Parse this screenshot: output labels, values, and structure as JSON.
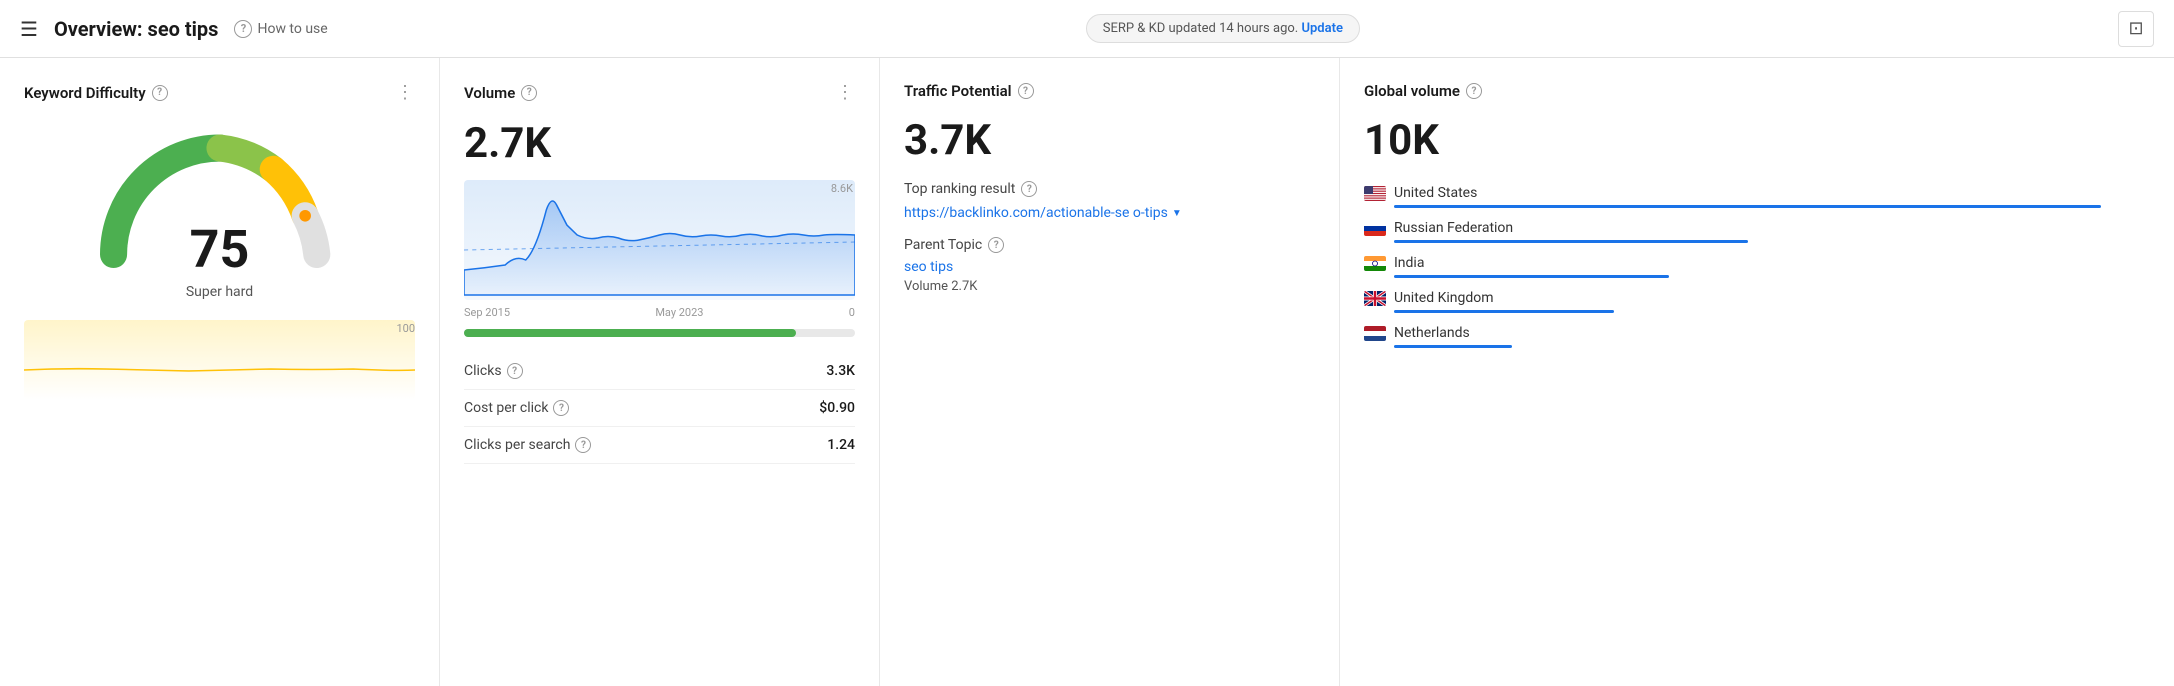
{
  "header": {
    "menu_icon": "☰",
    "title": "Overview: seo tips",
    "help_label": "How to use",
    "serp_text": "SERP & KD updated 14 hours ago.",
    "update_label": "Update",
    "action_icon": "◱"
  },
  "keyword_difficulty": {
    "title": "Keyword Difficulty",
    "value": "75",
    "label": "Super hard",
    "trend_max": "100"
  },
  "volume": {
    "title": "Volume",
    "value": "2.7K",
    "chart_max": "8.6K",
    "chart_min": "0",
    "date_start": "Sep 2015",
    "date_end": "May 2023",
    "progress_width": "85",
    "stats": [
      {
        "label": "Clicks",
        "value": "3.3K"
      },
      {
        "label": "Cost per click",
        "value": "$0.90"
      },
      {
        "label": "Clicks per search",
        "value": "1.24"
      }
    ]
  },
  "traffic_potential": {
    "title": "Traffic Potential",
    "value": "3.7K",
    "top_ranking_label": "Top ranking result",
    "ranking_url": "https://backlinko.com/actionable-se\no-tips",
    "parent_topic_label": "Parent Topic",
    "parent_topic_value": "seo tips",
    "parent_volume": "Volume 2.7K"
  },
  "global_volume": {
    "title": "Global volume",
    "value": "10K",
    "countries": [
      {
        "name": "United States",
        "flag": "us",
        "bar_width": "90",
        "bar_color": "#1a73e8"
      },
      {
        "name": "Russian Federation",
        "flag": "ru",
        "bar_width": "45",
        "bar_color": "#1a73e8"
      },
      {
        "name": "India",
        "flag": "in",
        "bar_width": "35",
        "bar_color": "#1a73e8"
      },
      {
        "name": "United Kingdom",
        "flag": "uk",
        "bar_width": "28",
        "bar_color": "#1a73e8"
      },
      {
        "name": "Netherlands",
        "flag": "nl",
        "bar_width": "15",
        "bar_color": "#1a73e8"
      }
    ]
  }
}
